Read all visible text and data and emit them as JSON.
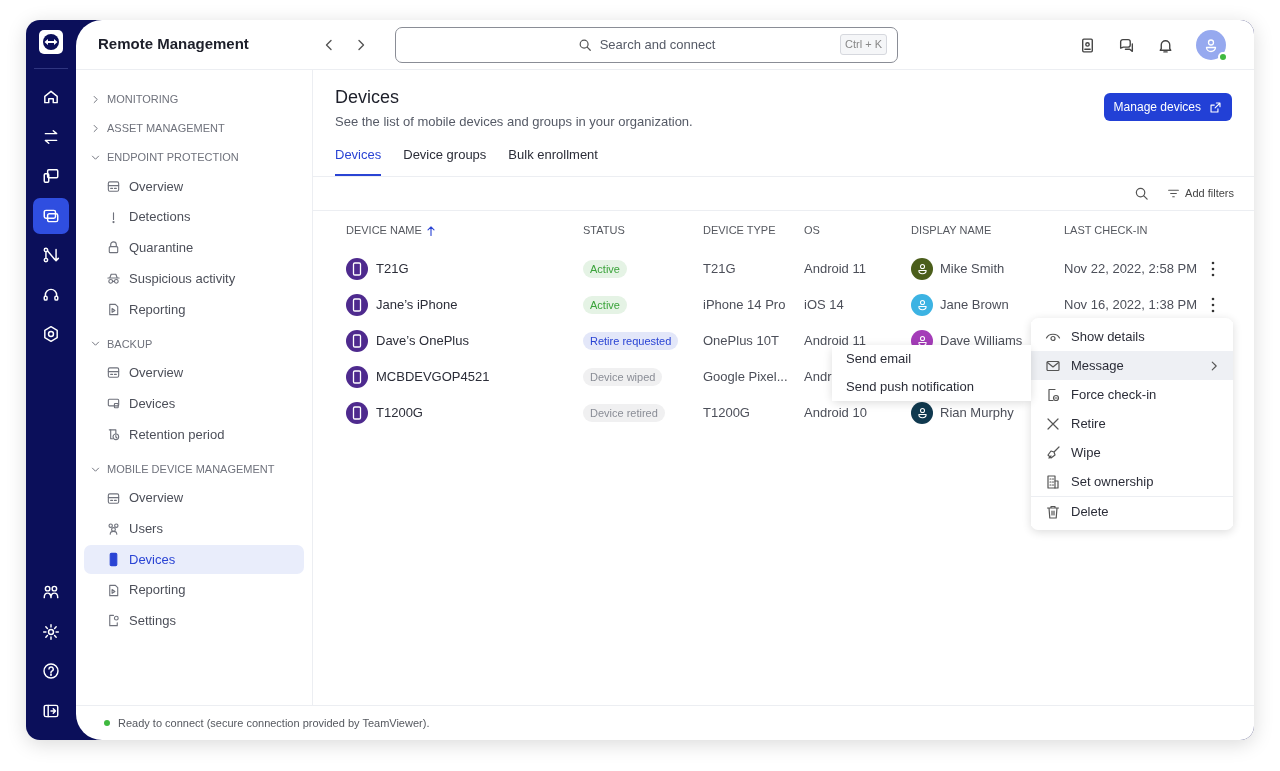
{
  "app": {
    "title": "Remote Management"
  },
  "rail": {
    "top": [
      {
        "selected": false
      },
      {
        "selected": false
      },
      {
        "selected": false
      },
      {
        "selected": true
      },
      {
        "selected": false
      },
      {
        "selected": false
      },
      {
        "selected": false
      }
    ],
    "bottom": [
      {
        "selected": false
      },
      {
        "selected": false
      },
      {
        "selected": false
      },
      {
        "selected": false
      }
    ]
  },
  "search": {
    "placeholder": "Search and connect",
    "shortcut": "Ctrl + K"
  },
  "sidebar": {
    "sections": [
      {
        "label": "MONITORING",
        "expanded": false
      },
      {
        "label": "ASSET MANAGEMENT",
        "expanded": false
      },
      {
        "label": "ENDPOINT PROTECTION",
        "expanded": true,
        "children": [
          {
            "label": "Overview",
            "selected": false
          },
          {
            "label": "Detections",
            "selected": false
          },
          {
            "label": "Quarantine",
            "selected": false
          },
          {
            "label": "Suspicious activity",
            "selected": false
          },
          {
            "label": "Reporting",
            "selected": false
          }
        ]
      },
      {
        "label": "BACKUP",
        "expanded": true,
        "children": [
          {
            "label": "Overview",
            "selected": false
          },
          {
            "label": "Devices",
            "selected": false
          },
          {
            "label": "Retention period",
            "selected": false
          }
        ]
      },
      {
        "label": "MOBILE DEVICE MANAGEMENT",
        "expanded": true,
        "children": [
          {
            "label": "Overview",
            "selected": false
          },
          {
            "label": "Users",
            "selected": false
          },
          {
            "label": "Devices",
            "selected": true
          },
          {
            "label": "Reporting",
            "selected": false
          },
          {
            "label": "Settings",
            "selected": false
          }
        ]
      }
    ]
  },
  "page": {
    "title": "Devices",
    "subtitle": "See the list of mobile devices and groups in your organization.",
    "action": "Manage devices"
  },
  "tabs": [
    {
      "label": "Devices",
      "selected": true
    },
    {
      "label": "Device groups",
      "selected": false
    },
    {
      "label": "Bulk enrollment",
      "selected": false
    }
  ],
  "toolbar": {
    "filters": "Add filters"
  },
  "table": {
    "columns": [
      "DEVICE NAME",
      "STATUS",
      "DEVICE TYPE",
      "OS",
      "DISPLAY NAME",
      "LAST CHECK-IN"
    ],
    "rows": [
      {
        "name": "T21G",
        "status": {
          "label": "Active",
          "color": "#3aa33a"
        },
        "type": "T21G",
        "os": "Android 11",
        "user": "Mike Smith",
        "color": "#4b5e1b",
        "checkin": "Nov 22, 2022, 2:58 PM",
        "menu": true
      },
      {
        "name": "Jane’s iPhone",
        "status": {
          "label": "Active",
          "color": "#3aa33a"
        },
        "type": "iPhone 14 Pro",
        "os": "iOS 14",
        "user": "Jane Brown",
        "color": "#3cb3e3",
        "checkin": "Nov 16, 2022, 1:38 PM",
        "menu": true
      },
      {
        "name": "Dave’s OnePlus",
        "status": {
          "label": "Retire requested",
          "color": "#2a44d4"
        },
        "type": "OnePlus 10T",
        "os": "Android 11",
        "user": "Dave Williams",
        "color": "#a43cb8"
      },
      {
        "name": "MCBDEVGOP4521",
        "status": {
          "label": "Device wiped",
          "color": "#8a8d96"
        },
        "type": "Google Pixel...",
        "os": "Andr"
      },
      {
        "name": "T1200G",
        "status": {
          "label": "Device retired",
          "color": "#8a8d96"
        },
        "type": "T1200G",
        "os": "Android 10",
        "user": "Rian Murphy",
        "color": "#10394f"
      }
    ]
  },
  "context_menu": {
    "items": [
      {
        "label": "Show details",
        "selected": false
      },
      {
        "label": "Message",
        "selected": true,
        "submenu": true
      },
      {
        "label": "Force check-in",
        "selected": false
      },
      {
        "label": "Retire",
        "selected": false
      },
      {
        "label": "Wipe",
        "selected": false
      },
      {
        "label": "Set ownership",
        "selected": false
      },
      {
        "label": "Delete",
        "selected": false,
        "divider": true
      }
    ],
    "submenu": [
      "Send email",
      "Send push notification"
    ]
  },
  "status_bar": {
    "text": "Ready to connect (secure connection provided by TeamViewer).",
    "connected": true
  }
}
